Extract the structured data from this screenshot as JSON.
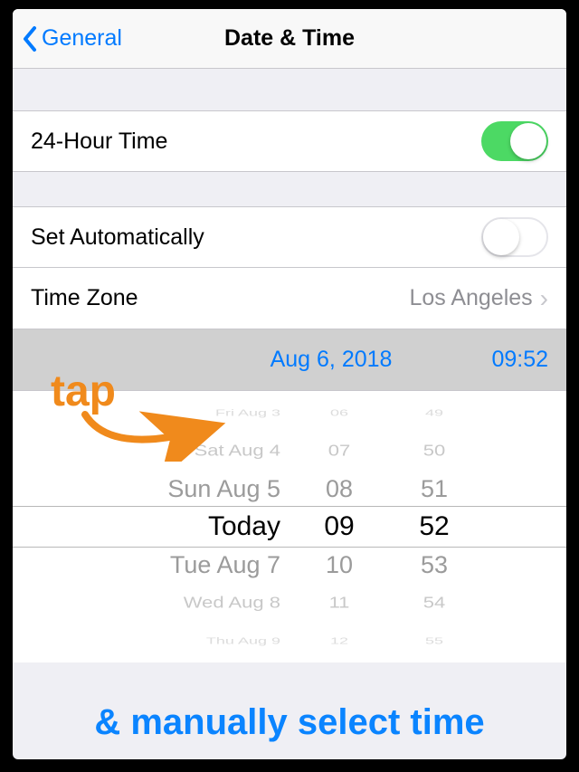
{
  "nav": {
    "back_label": "General",
    "title": "Date & Time"
  },
  "rows": {
    "twenty_four_hour": {
      "label": "24-Hour Time",
      "on": true
    },
    "set_auto": {
      "label": "Set Automatically",
      "on": false
    },
    "time_zone": {
      "label": "Time Zone",
      "value": "Los Angeles"
    }
  },
  "datetime": {
    "date": "Aug 6, 2018",
    "time": "09:52"
  },
  "picker": {
    "dates": [
      "Fri Aug 3",
      "Sat Aug 4",
      "Sun Aug 5",
      "Today",
      "Tue Aug 7",
      "Wed Aug 8",
      "Thu Aug 9"
    ],
    "hours": [
      "06",
      "07",
      "08",
      "09",
      "10",
      "11",
      "12"
    ],
    "minutes": [
      "49",
      "50",
      "51",
      "52",
      "53",
      "54",
      "55"
    ]
  },
  "annotations": {
    "tap": "tap",
    "bottom": "& manually select time"
  },
  "colors": {
    "ios_blue": "#007aff",
    "toggle_green": "#4cd964",
    "annotation_orange": "#f08a1c",
    "annotation_blue": "#0a84ff"
  }
}
